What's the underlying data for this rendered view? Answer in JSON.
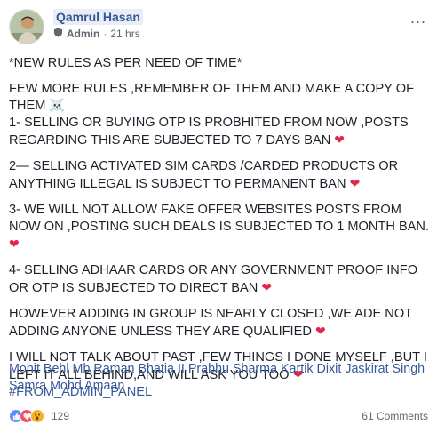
{
  "post": {
    "author": "Qamrul Hasan",
    "role": "Admin",
    "time": "21 hrs",
    "more_label": "...",
    "lines": {
      "l1": "*NEW RULES AS PER NEED OF TIME*",
      "l2": "FEW MORE RULES ,REMEMBER OF THEM AND MAKE A COPY OF THEM ☠️",
      "l3": "1- SELLING OR BUYING OTP IS PROBHITED FROM NOW ,POSTS REGARDING THIS ARE SUBJECTED TO 7 DAYS BAN",
      "l4": "2— SELLING ACTIVATED SIM CARDS /CARDED PRODUCTS OR ANYTHING ILLEGAL IS SUBJECT TO PERMANENT BAN",
      "l5": "3- WE WILL NOT ALLOW FAKE OFFER WEBSITES POSTS FROM NOW ON ,POSTING SUCH DEALS IS SUBJECTED TO 1 MONTH BAN.",
      "l6": "4- SELLING ADHAAR CARDS OR ANY GOVERNMENT PROOF INFO OR OTP IS SUBJECTED TO DIRECT BAN",
      "l7": "HOWEVER ADDING IN GROUP IS NEARLY CLOSED ,WE ADE NOT ADDING ANYONE UNLESS THEY ARE QUALIFIED",
      "l8": "I WILL NOT TALK ABOUT PAST ,FEW THINGS I DONE MYSELF ,BUT I LEFT IT ALL BEHIND,AND WILL ASK YOU TOO",
      "hashtag": "#FROM_ADMIN_PANEL"
    },
    "heart": "❤",
    "mentions": [
      "Mohit Behl",
      "Mb Raman Bhatia II",
      "Prabhu Sharma",
      "Kartik Dixit",
      "Jaskirat Singh Samra",
      "Mohd Amaan"
    ],
    "reaction_count": "129",
    "comments": "61 Comments"
  },
  "icons": {
    "more": "more-options-icon",
    "globe": "admin-badge-icon",
    "reactions": [
      "like-reaction-icon",
      "love-reaction-icon",
      "wow-reaction-icon"
    ]
  },
  "colors": {
    "link": "#365899",
    "heart": "#e2264d",
    "like": "#5890ff",
    "love": "#f25268",
    "wow": "#f7b125"
  }
}
